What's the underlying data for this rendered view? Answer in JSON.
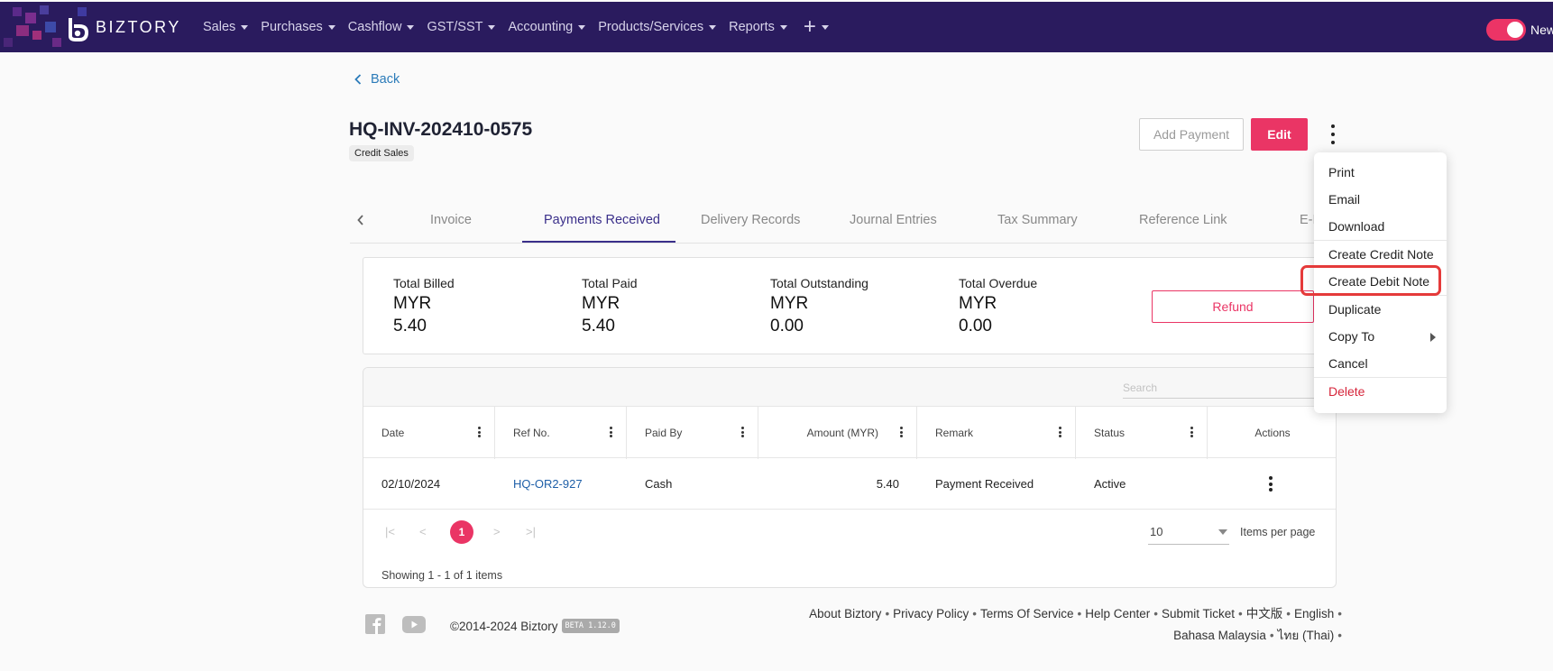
{
  "nav": {
    "brand": "BIZTORY",
    "items": [
      "Sales",
      "Purchases",
      "Cashflow",
      "GST/SST",
      "Accounting",
      "Products/Services",
      "Reports"
    ],
    "plus": "+",
    "toggle_label": "New"
  },
  "page": {
    "back": "Back",
    "title": "HQ-INV-202410-0575",
    "badge": "Credit Sales",
    "add_payment": "Add Payment",
    "edit": "Edit"
  },
  "tabs": [
    "Invoice",
    "Payments Received",
    "Delivery Records",
    "Journal Entries",
    "Tax Summary",
    "Reference Link",
    "E-I"
  ],
  "summary": {
    "billed_label": "Total Billed",
    "billed_currency": "MYR",
    "billed_value": "5.40",
    "paid_label": "Total Paid",
    "paid_currency": "MYR",
    "paid_value": "5.40",
    "outstanding_label": "Total Outstanding",
    "outstanding_currency": "MYR",
    "outstanding_value": "0.00",
    "overdue_label": "Total Overdue",
    "overdue_currency": "MYR",
    "overdue_value": "0.00",
    "refund": "Refund"
  },
  "table": {
    "search_placeholder": "Search",
    "headers": [
      "Date",
      "Ref No.",
      "Paid By",
      "Amount (MYR)",
      "Remark",
      "Status",
      "Actions"
    ],
    "rows": [
      [
        "02/10/2024",
        "HQ-OR2-927",
        "Cash",
        "5.40",
        "Payment Received",
        "Active"
      ]
    ],
    "pager": {
      "current": "1",
      "first": "|<",
      "prev": "<",
      "next": ">",
      "last": ">|",
      "per_page": "10",
      "per_page_label": "Items per page",
      "showing": "Showing 1 - 1 of 1 items"
    }
  },
  "footer": {
    "copyright": "©2014-2024 Biztory",
    "beta": "BETA 1.12.0",
    "links_line1": [
      "About Biztory",
      "Privacy Policy",
      "Terms Of Service",
      "Help Center",
      "Submit Ticket",
      "中文版",
      "English"
    ],
    "links_line2": [
      "Bahasa Malaysia",
      "ไทย (Thai)"
    ]
  },
  "menu": {
    "items": [
      "Print",
      "Email",
      "Download",
      "Create Credit Note",
      "Create Debit Note",
      "Duplicate",
      "Copy To",
      "Cancel",
      "Delete"
    ]
  },
  "colors": {
    "nav_bg": "#2a1b5e",
    "accent": "#ea3565",
    "active_tab": "#3a2f8a",
    "link": "#1e5fa8",
    "highlight": "#e53a3a"
  }
}
